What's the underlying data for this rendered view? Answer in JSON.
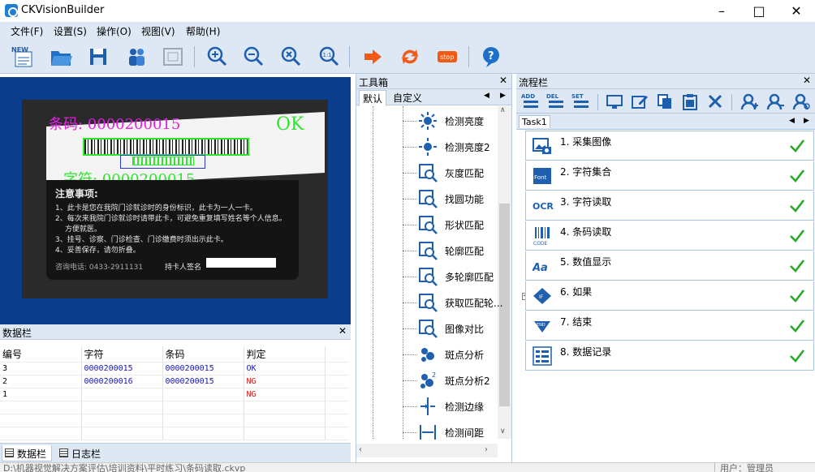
{
  "app": {
    "title": "CKVisionBuilder"
  },
  "menu": [
    {
      "label": "文件(F)"
    },
    {
      "label": "设置(S)"
    },
    {
      "label": "操作(O)"
    },
    {
      "label": "视图(V)"
    },
    {
      "label": "帮助(H)"
    }
  ],
  "toolbar": {
    "new_label": "NEW",
    "stop_label": "stop"
  },
  "viewer": {
    "barcode_text": "条码: 0000200015",
    "char_text": "字符: 0000200015",
    "result_text": "OK",
    "card_title": "注意事项:",
    "card_lines": [
      "1、此卡是您在我院门诊就诊时的身份标识，此卡为一人一卡。",
      "2、每次来我院门诊就诊时请带此卡，可避免重复填写姓名等个人信息。",
      "方便就医。",
      "3、挂号、诊察、门诊检查、门诊缴费时须出示此卡。",
      "4、妥善保存，请勿折叠。"
    ],
    "card_phone": "咨询电话: 0433-2911131",
    "card_holder": "持卡人签名",
    "colors": {
      "barcode": "#e020e0",
      "char": "#2ee62e",
      "ok": "#2ee62e"
    }
  },
  "datapanel": {
    "title": "数据栏",
    "columns": [
      "编号",
      "字符",
      "条码",
      "判定"
    ],
    "rows": [
      {
        "id": "3",
        "char": "0000200015",
        "code": "0000200015",
        "result": "OK"
      },
      {
        "id": "2",
        "char": "0000200016",
        "code": "0000200015",
        "result": "NG"
      },
      {
        "id": "1",
        "char": "",
        "code": "",
        "result": "NG"
      }
    ]
  },
  "bottomtabs": [
    {
      "label": "数据栏"
    },
    {
      "label": "日志栏"
    }
  ],
  "statusbar": {
    "left": "D:\\机器视觉解决方案评估\\培训资料\\平时练习\\条码读取.ckvp",
    "right": "用户：管理员"
  },
  "toolbox": {
    "title": "工具箱",
    "tabs": [
      {
        "label": "默认"
      },
      {
        "label": "自定义"
      }
    ],
    "items": [
      {
        "label": "检测亮度",
        "icon": "brightness-icon"
      },
      {
        "label": "检测亮度2",
        "icon": "brightness2-icon"
      },
      {
        "label": "灰度匹配",
        "icon": "gray-match-icon"
      },
      {
        "label": "找圆功能",
        "icon": "find-circle-icon"
      },
      {
        "label": "形状匹配",
        "icon": "shape-match-icon"
      },
      {
        "label": "轮廓匹配",
        "icon": "contour-match-icon"
      },
      {
        "label": "多轮廓匹配",
        "icon": "multi-contour-icon"
      },
      {
        "label": "获取匹配轮...",
        "icon": "get-contour-icon"
      },
      {
        "label": "图像对比",
        "icon": "image-compare-icon"
      },
      {
        "label": "斑点分析",
        "icon": "blob-icon"
      },
      {
        "label": "斑点分析2",
        "icon": "blob2-icon"
      },
      {
        "label": "检测边缘",
        "icon": "edge-icon"
      },
      {
        "label": "检测间距",
        "icon": "distance-icon"
      }
    ]
  },
  "flow": {
    "title": "流程栏",
    "toolbar_add": "ADD",
    "toolbar_del": "DEL",
    "toolbar_set": "SET",
    "task_tab": "Task1",
    "steps": [
      {
        "label": "1. 采集图像",
        "icon": "capture-image-icon"
      },
      {
        "label": "2. 字符集合",
        "icon": "font-icon",
        "icon_text": "Font"
      },
      {
        "label": "3. 字符读取",
        "icon": "ocr-icon",
        "icon_text": "OCR"
      },
      {
        "label": "4. 条码读取",
        "icon": "barcode-icon",
        "icon_text": "CODE"
      },
      {
        "label": "5. 数值显示",
        "icon": "value-display-icon",
        "icon_text": "Aa"
      },
      {
        "label": "6. 如果",
        "icon": "if-icon",
        "icon_text": "IF"
      },
      {
        "label": "7. 结束",
        "icon": "end-icon",
        "icon_text": "END"
      },
      {
        "label": "8. 数据记录",
        "icon": "data-record-icon"
      }
    ],
    "check_color": "#2aa82a"
  }
}
